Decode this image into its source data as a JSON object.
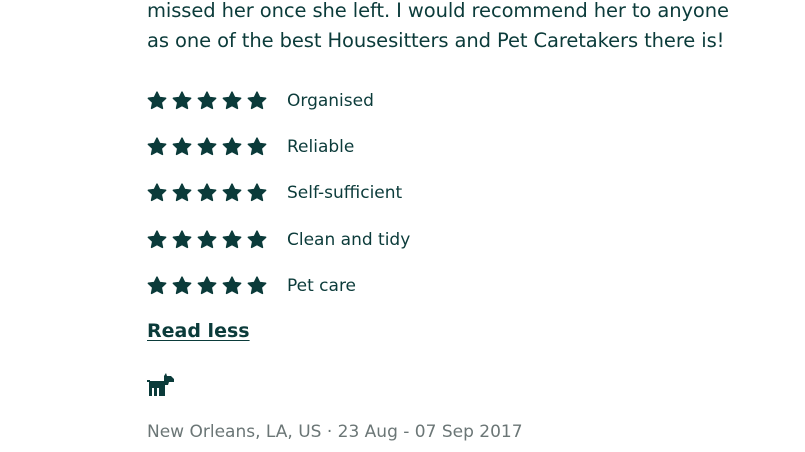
{
  "review": {
    "text_line_1": "missed her once she left. I would recommend her to anyone",
    "text_line_2": "as one of the best Housesitters and Pet Caretakers there is!"
  },
  "ratings": [
    {
      "label": "Organised",
      "stars": 5,
      "max_stars": 5
    },
    {
      "label": "Reliable",
      "stars": 5,
      "max_stars": 5
    },
    {
      "label": "Self-sufficient",
      "stars": 5,
      "max_stars": 5
    },
    {
      "label": "Clean and tidy",
      "stars": 5,
      "max_stars": 5
    },
    {
      "label": "Pet care",
      "stars": 5,
      "max_stars": 5
    }
  ],
  "read_less_label": "Read less",
  "pet_icon": "dog-icon",
  "meta": {
    "location_dates": "New Orleans, LA, US · 23 Aug - 07 Sep 2017"
  },
  "colors": {
    "primary": "#0b3b3a",
    "muted": "#6b7676",
    "background": "#ffffff"
  }
}
